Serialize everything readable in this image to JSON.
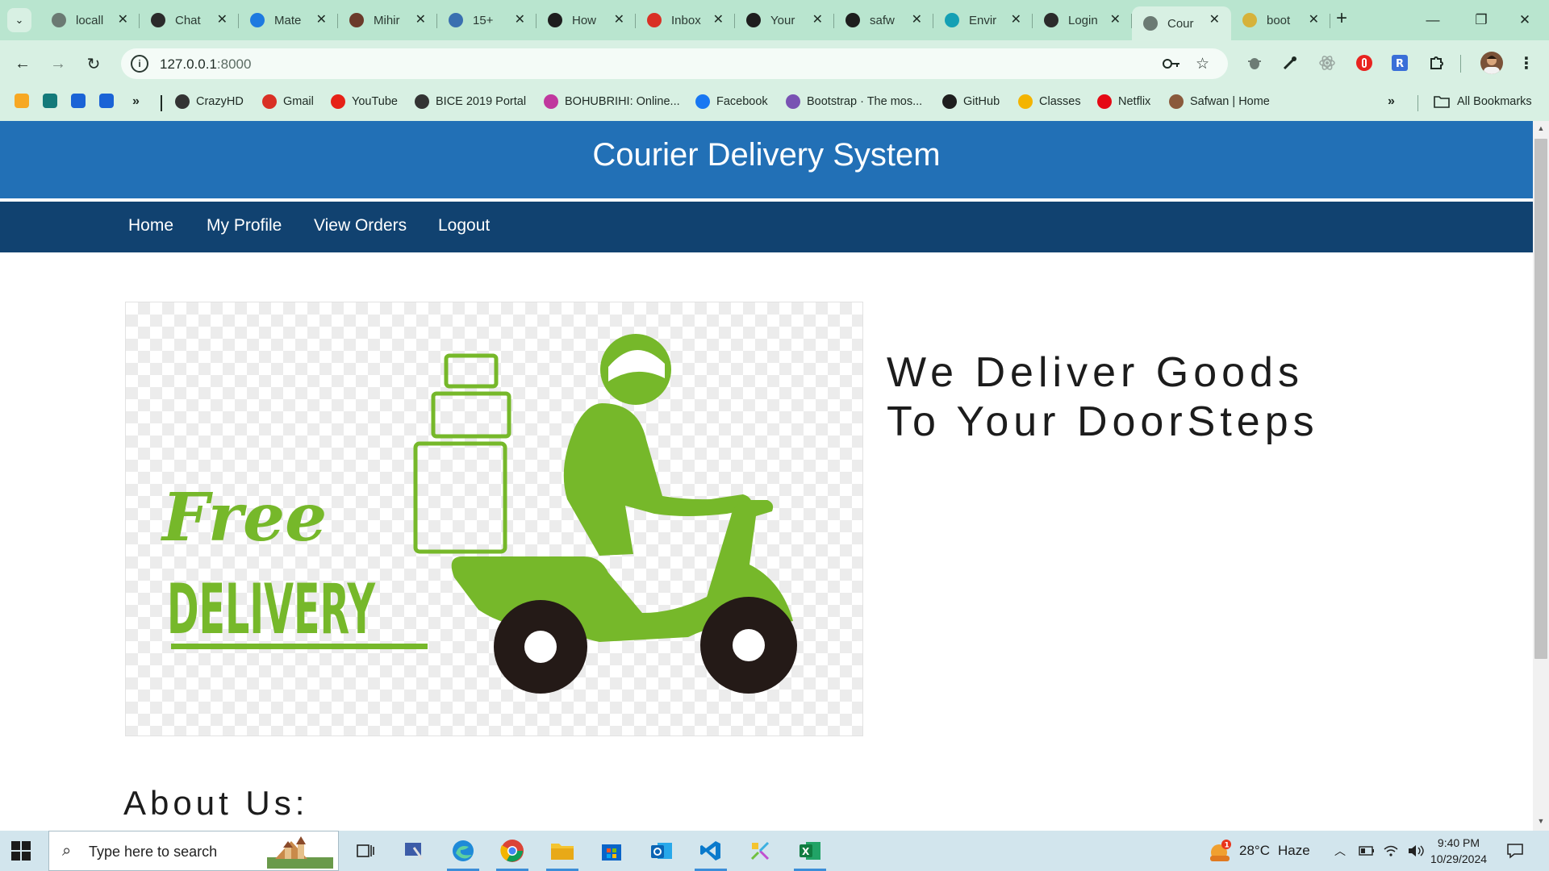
{
  "browser": {
    "tabs": [
      {
        "title": "locall",
        "icon": "globe-icon",
        "color": "#6b7a73"
      },
      {
        "title": "Chat",
        "icon": "chatgpt-icon",
        "color": "#2b2b2b"
      },
      {
        "title": "Mate",
        "icon": "mui-icon",
        "color": "#1e7ae0"
      },
      {
        "title": "Mihir",
        "icon": "avatar-icon",
        "color": "#6b3a2a"
      },
      {
        "title": "15+",
        "icon": "user-icon",
        "color": "#3a6fb0"
      },
      {
        "title": "How",
        "icon": "page-icon",
        "color": "#1e1e1e"
      },
      {
        "title": "Inbox",
        "icon": "gmail-icon",
        "color": "#d93025"
      },
      {
        "title": "Your",
        "icon": "github-icon",
        "color": "#1e1e1e"
      },
      {
        "title": "safw",
        "icon": "github-icon",
        "color": "#1e1e1e"
      },
      {
        "title": "Envir",
        "icon": "diamond-icon",
        "color": "#14a0b4"
      },
      {
        "title": "Login",
        "icon": "leaf-icon",
        "color": "#2b2b2b"
      },
      {
        "title": "Cour",
        "icon": "globe-icon",
        "color": "#6b7a73",
        "active": true
      },
      {
        "title": "boot",
        "icon": "bootstrap-icon",
        "color": "#d6b23a"
      }
    ],
    "close_glyph": "✕",
    "new_tab_glyph": "+",
    "url_host": "127.0.0.1",
    "url_port": ":8000",
    "bookmarks": [
      {
        "label": "CrazyHD",
        "icon": "globe-icon",
        "color": "#333333"
      },
      {
        "label": "Gmail",
        "icon": "gmail-icon",
        "color": "#d93025"
      },
      {
        "label": "YouTube",
        "icon": "youtube-icon",
        "color": "#e62117"
      },
      {
        "label": "BICE 2019 Portal",
        "icon": "globe-icon",
        "color": "#333333"
      },
      {
        "label": "BOHUBRIHI: Online...",
        "icon": "bottle-icon",
        "color": "#c0389e"
      },
      {
        "label": "Facebook",
        "icon": "facebook-icon",
        "color": "#1877f2"
      },
      {
        "label": "Bootstrap · The mos...",
        "icon": "bootstrap-icon",
        "color": "#7952b3"
      },
      {
        "label": "GitHub",
        "icon": "github-icon",
        "color": "#1e1e1e"
      },
      {
        "label": "Classes",
        "icon": "classroom-icon",
        "color": "#f4b400"
      },
      {
        "label": "Netflix",
        "icon": "netflix-icon",
        "color": "#e50914"
      },
      {
        "label": "Safwan | Home",
        "icon": "avatar-icon",
        "color": "#8a5a3c"
      }
    ],
    "all_bookmarks": "All Bookmarks"
  },
  "site": {
    "title": "Courier Delivery System",
    "nav": [
      "Home",
      "My Profile",
      "View Orders",
      "Logout"
    ],
    "hero_line1": "We Deliver Goods",
    "hero_line2": "To Your DoorSteps",
    "about_heading": "About Us:",
    "image_text_free": "Free",
    "image_text_delivery": "DELIVERY"
  },
  "taskbar": {
    "search_placeholder": "Type here to search",
    "weather_temp": "28°C",
    "weather_desc": "Haze",
    "weather_badge": "1",
    "time": "9:40 PM",
    "date": "10/29/2024"
  },
  "colors": {
    "header_blue": "#2270b6",
    "nav_navy": "#114270",
    "scooter_green": "#76b82a",
    "chrome_green": "#b9e5cf"
  }
}
